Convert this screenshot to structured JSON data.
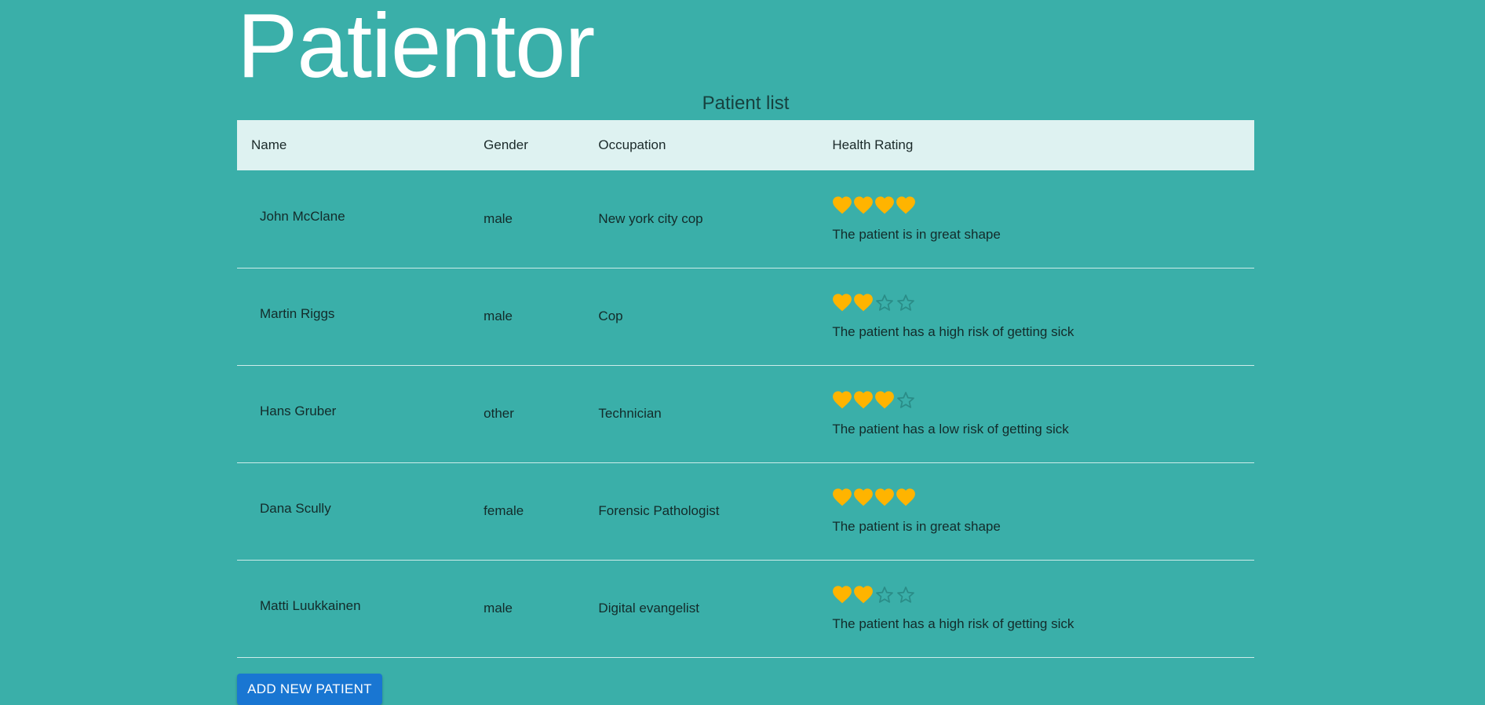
{
  "app": {
    "title": "Patientor"
  },
  "patient_list": {
    "title": "Patient list",
    "columns": {
      "name": "Name",
      "gender": "Gender",
      "occupation": "Occupation",
      "health_rating": "Health Rating"
    },
    "rows": [
      {
        "name": "John McClane",
        "gender": "male",
        "occupation": "New york city cop",
        "rating_filled": 4,
        "rating_max": 4,
        "health_text": "The patient is in great shape"
      },
      {
        "name": "Martin Riggs",
        "gender": "male",
        "occupation": "Cop",
        "rating_filled": 2,
        "rating_max": 4,
        "health_text": "The patient has a high risk of getting sick"
      },
      {
        "name": "Hans Gruber",
        "gender": "other",
        "occupation": "Technician",
        "rating_filled": 3,
        "rating_max": 4,
        "health_text": "The patient has a low risk of getting sick"
      },
      {
        "name": "Dana Scully",
        "gender": "female",
        "occupation": "Forensic Pathologist",
        "rating_filled": 4,
        "rating_max": 4,
        "health_text": "The patient is in great shape"
      },
      {
        "name": "Matti Luukkainen",
        "gender": "male",
        "occupation": "Digital evangelist",
        "rating_filled": 2,
        "rating_max": 4,
        "health_text": "The patient has a high risk of getting sick"
      }
    ]
  },
  "actions": {
    "add_patient_label": "ADD NEW PATIENT"
  },
  "icons": {
    "filled": "heart-icon",
    "empty": "star-outline-icon"
  },
  "colors": {
    "background": "#3aafa9",
    "header_row": "#def2f1",
    "heart": "#ffb400",
    "star_outline": "#2a8c87",
    "button": "#1976d2"
  }
}
